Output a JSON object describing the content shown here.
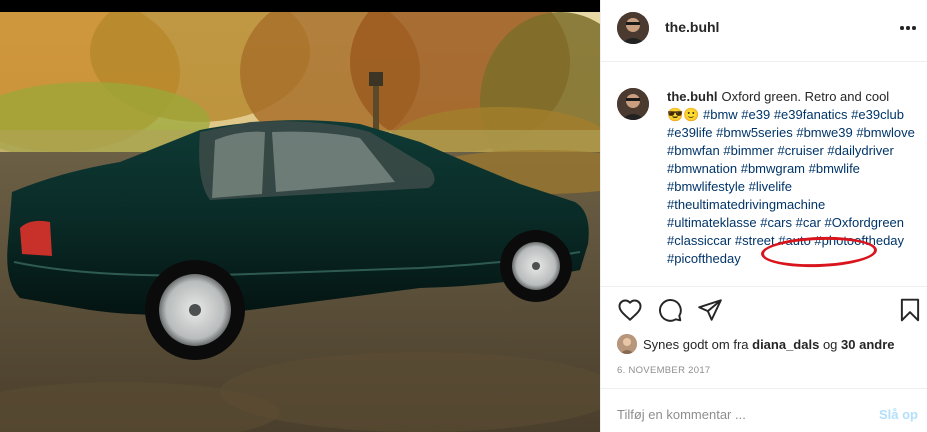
{
  "post": {
    "username": "the.buhl",
    "caption_text": "Oxford green. Retro and cool",
    "caption_emoji": "😎🙂",
    "caption_tags": "#bmw #e39 #e39fanatics #e39club #e39life #bmw5series #bmwe39 #bmwlove #bmwfan #bimmer #cruiser #dailydriver #bmwnation #bmwgram #bmwlife #bmwlifestyle #livelife #theultimatedrivingmachine #ultimateklasse #cars #car #Oxfordgreen #classiccar #street #auto #photooftheday #picoftheday",
    "highlighted_tag": "#dailydriver"
  },
  "likes": {
    "prefix": "Synes godt om fra ",
    "user": "diana_dals",
    "joiner": " og ",
    "others": "30 andre"
  },
  "date": "6. NOVEMBER 2017",
  "comment": {
    "placeholder": "Tilføj en kommentar ...",
    "post_label": "Slå op"
  },
  "icons": {
    "more": "more-options-icon",
    "like": "heart-icon",
    "comment": "comment-bubble-icon",
    "share": "paper-plane-icon",
    "save": "bookmark-icon"
  },
  "colors": {
    "tag_link": "#003569",
    "highlight_ring": "#d8141c",
    "post_disabled": "#b2dffc",
    "muted": "#8e8e8e"
  }
}
